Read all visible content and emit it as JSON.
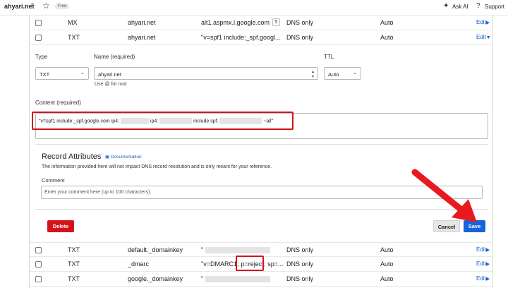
{
  "topbar": {
    "account": "ahyari.net",
    "plan_badge": "Free",
    "ask_ai": "Ask AI",
    "support": "Support"
  },
  "rows_top": [
    {
      "type": "MX",
      "name": "ahyari.net",
      "content": "alt1.aspmx.l.google.com",
      "priority": "5",
      "proxy": "DNS only",
      "ttl": "Auto",
      "edit": "Edit"
    },
    {
      "type": "TXT",
      "name": "ahyari.net",
      "content": "\"v=spf1 include:_spf.googl...",
      "proxy": "DNS only",
      "ttl": "Auto",
      "edit": "Edit"
    }
  ],
  "form": {
    "type_label": "Type",
    "type_value": "TXT",
    "name_label": "Name (required)",
    "name_value": "ahyari.net",
    "name_hint": "Use @ for root",
    "ttl_label": "TTL",
    "ttl_value": "Auto",
    "content_label": "Content (required)",
    "content_parts": [
      "\"v=spf1 include:_spf.google.com ip4:",
      "ip4:",
      "include:spf.",
      "~all\""
    ]
  },
  "attributes": {
    "title": "Record Attributes",
    "doc_link": "Documentation",
    "description": "The information provided here will not impact DNS record resolution and is only meant for your reference.",
    "comment_label": "Comment",
    "comment_placeholder": "Enter your comment here (up to 100 characters)."
  },
  "buttons": {
    "delete": "Delete",
    "cancel": "Cancel",
    "save": "Save"
  },
  "rows_bottom": [
    {
      "type": "TXT",
      "name": "default._domainkey",
      "content": "\"",
      "proxy": "DNS only",
      "ttl": "Auto",
      "edit": "Edit"
    },
    {
      "type": "TXT",
      "name": "_dmarc",
      "content_a": "\"v=DMARC1;",
      "content_b": "p=reject;",
      "content_c": "sp=...",
      "proxy": "DNS only",
      "ttl": "Auto",
      "edit": "Edit"
    },
    {
      "type": "TXT",
      "name": "google._domainkey",
      "content": "\"",
      "proxy": "DNS only",
      "ttl": "Auto",
      "edit": "Edit"
    }
  ],
  "colors": {
    "accent": "#1664d9",
    "danger": "#d4121c",
    "annotation": "#e8191f"
  },
  "icons": [
    "chevron-updown-icon",
    "star-icon",
    "sparkle-icon",
    "help-circle-icon",
    "triangle-right-icon",
    "triangle-down-icon",
    "chevron-down-icon",
    "book-icon"
  ]
}
